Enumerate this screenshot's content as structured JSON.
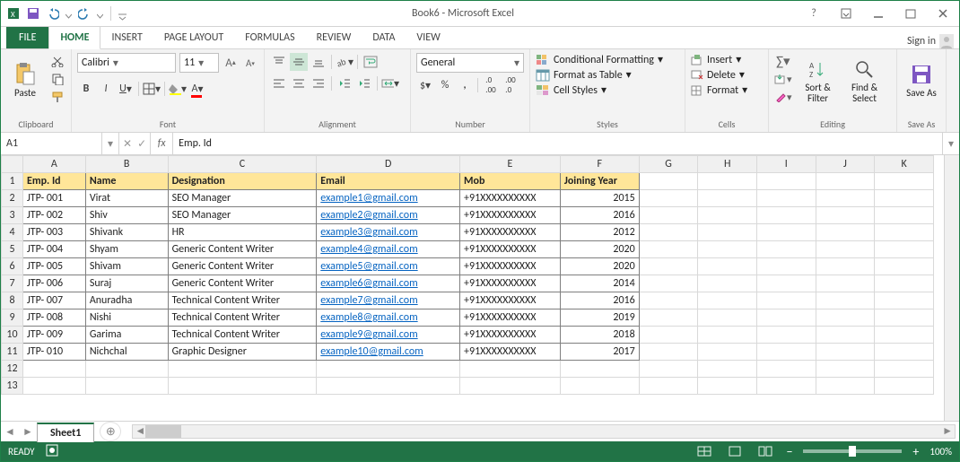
{
  "title": "Book6 - Microsoft Excel",
  "tabs": {
    "file": "FILE",
    "home": "HOME",
    "insert": "INSERT",
    "page_layout": "PAGE LAYOUT",
    "formulas": "FORMULAS",
    "review": "REVIEW",
    "data": "DATA",
    "view": "VIEW"
  },
  "signin": "Sign in",
  "ribbon": {
    "clipboard": {
      "paste": "Paste",
      "label": "Clipboard"
    },
    "font": {
      "family": "Calibri",
      "size": "11",
      "label": "Font"
    },
    "alignment": {
      "label": "Alignment"
    },
    "number": {
      "format": "General",
      "label": "Number"
    },
    "styles": {
      "cond": "Conditional Formatting",
      "table": "Format as Table",
      "cell": "Cell Styles",
      "label": "Styles"
    },
    "cells": {
      "insert": "Insert",
      "delete": "Delete",
      "format": "Format",
      "label": "Cells"
    },
    "editing": {
      "sort": "Sort & Filter",
      "find": "Find & Select",
      "label": "Editing"
    },
    "save": {
      "save": "Save As",
      "label": "Save As"
    }
  },
  "namebox": "A1",
  "formula": "Emp. Id",
  "columns": [
    "A",
    "B",
    "C",
    "D",
    "E",
    "F",
    "G",
    "H",
    "I",
    "J",
    "K"
  ],
  "headers": {
    "A": "Emp. Id",
    "B": "Name",
    "C": "Designation",
    "D": "Email",
    "E": "Mob",
    "F": "Joining Year"
  },
  "rows": [
    {
      "n": 2,
      "A": "JTP- 001",
      "B": "Virat",
      "C": "SEO Manager",
      "D": "example1@gmail.com",
      "E": "+91XXXXXXXXXX",
      "F": "2015"
    },
    {
      "n": 3,
      "A": "JTP- 002",
      "B": "Shiv",
      "C": "SEO Manager",
      "D": "example2@gmail.com",
      "E": "+91XXXXXXXXXX",
      "F": "2016"
    },
    {
      "n": 4,
      "A": "JTP- 003",
      "B": "Shivank",
      "C": "HR",
      "D": "example3@gmail.com",
      "E": "+91XXXXXXXXXX",
      "F": "2012"
    },
    {
      "n": 5,
      "A": "JTP- 004",
      "B": "Shyam",
      "C": "Generic Content Writer",
      "D": "example4@gmail.com",
      "E": "+91XXXXXXXXXX",
      "F": "2020"
    },
    {
      "n": 6,
      "A": "JTP- 005",
      "B": "Shivam",
      "C": "Generic Content Writer",
      "D": "example5@gmail.com",
      "E": "+91XXXXXXXXXX",
      "F": "2020"
    },
    {
      "n": 7,
      "A": "JTP- 006",
      "B": "Suraj",
      "C": "Generic Content Writer",
      "D": "example6@gmail.com",
      "E": "+91XXXXXXXXXX",
      "F": "2014"
    },
    {
      "n": 8,
      "A": "JTP- 007",
      "B": "Anuradha",
      "C": "Technical Content Writer",
      "D": "example7@gmail.com",
      "E": "+91XXXXXXXXXX",
      "F": "2016"
    },
    {
      "n": 9,
      "A": "JTP- 008",
      "B": "Nishi",
      "C": "Technical Content Writer",
      "D": "example8@gmail.com",
      "E": "+91XXXXXXXXXX",
      "F": "2019"
    },
    {
      "n": 10,
      "A": "JTP- 009",
      "B": "Garima",
      "C": "Technical Content Writer",
      "D": "example9@gmail.com",
      "E": "+91XXXXXXXXXX",
      "F": "2018"
    },
    {
      "n": 11,
      "A": "JTP- 010",
      "B": "Nichchal",
      "C": "Graphic Designer",
      "D": "example10@gmail.com",
      "E": "+91XXXXXXXXXX",
      "F": "2017"
    }
  ],
  "blank_rows": [
    12,
    13
  ],
  "sheet_tab": "Sheet1",
  "status": {
    "ready": "READY",
    "zoom": "100%"
  }
}
